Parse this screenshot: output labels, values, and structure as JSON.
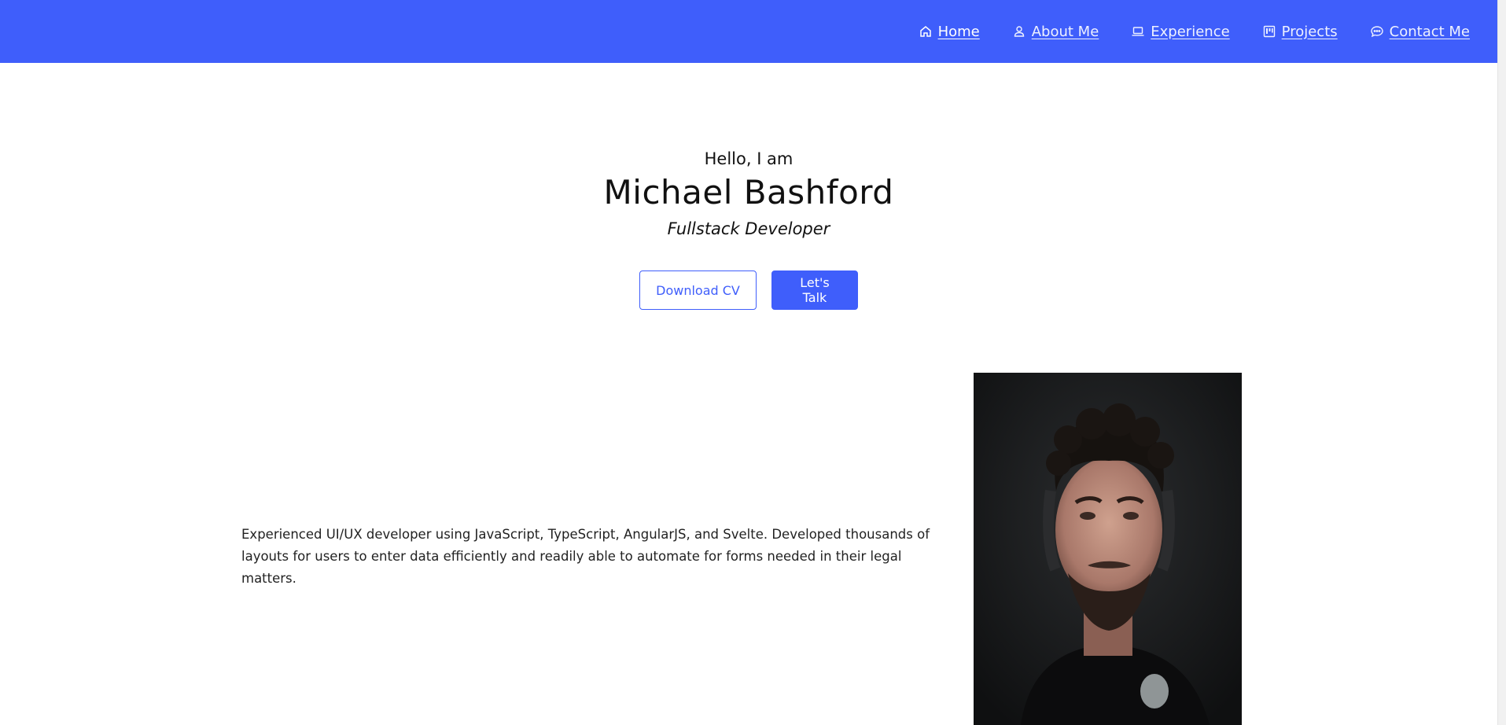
{
  "nav": {
    "items": [
      {
        "label": "Home",
        "icon": "home-icon",
        "active": true
      },
      {
        "label": "About Me",
        "icon": "user-icon",
        "active": false
      },
      {
        "label": "Experience",
        "icon": "laptop-icon",
        "active": false
      },
      {
        "label": "Projects",
        "icon": "kanban-icon",
        "active": false
      },
      {
        "label": "Contact Me",
        "icon": "chat-icon",
        "active": false
      }
    ]
  },
  "hero": {
    "greeting": "Hello, I am",
    "name": "Michael Bashford",
    "role": "Fullstack Developer",
    "download_label": "Download CV",
    "talk_label": "Let's Talk"
  },
  "about": {
    "bio": "Experienced UI/UX developer using JavaScript, TypeScript, AngularJS, and Svelte. Developed thousands of layouts for users to enter data efficiently and readily able to automate for forms needed in their legal matters."
  },
  "colors": {
    "accent": "#3f5efb",
    "background": "#ffffff",
    "text": "#111111"
  }
}
